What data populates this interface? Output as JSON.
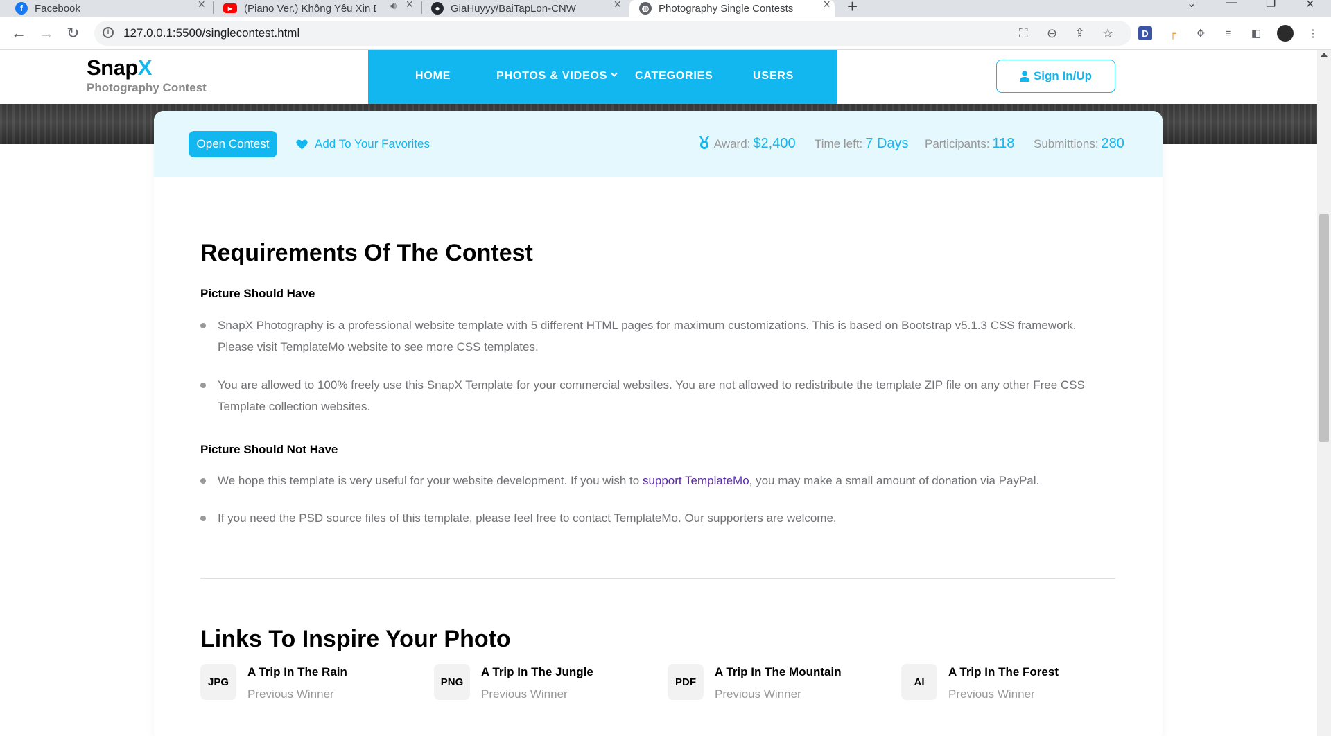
{
  "browser": {
    "tabs": [
      {
        "title": "Facebook",
        "active": false
      },
      {
        "title": "(Piano Ver.) Không Yêu Xin Đừng...",
        "active": false
      },
      {
        "title": "GiaHuyyy/BaiTapLon-CNW",
        "active": false
      },
      {
        "title": "Photography Single Contests",
        "active": true
      }
    ],
    "url": "127.0.0.1:5500/singlecontest.html"
  },
  "header": {
    "brand_main": "Snap",
    "brand_x": "X",
    "brand_sub": "Photography Contest",
    "nav": [
      "HOME",
      "PHOTOS & VIDEOS",
      "CATEGORIES",
      "USERS"
    ],
    "signin_label": "Sign In/Up"
  },
  "contest": {
    "open_label": "Open Contest",
    "favorite_label": "Add To Your Favorites",
    "award_label": "Award:",
    "award_value": "$2,400",
    "time_label": "Time left:",
    "time_value": "7 Days",
    "participants_label": "Participants:",
    "participants_value": "118",
    "submissions_label": "Submittions:",
    "submissions_value": "280"
  },
  "requirements": {
    "title": "Requirements Of The Contest",
    "should_have_title": "Picture Should Have",
    "should_have": [
      "SnapX Photography is a professional website template with 5 different HTML pages for maximum customizations. This is based on Bootstrap v5.1.3 CSS framework. Please visit TemplateMo website to see more CSS templates.",
      "You are allowed to 100% freely use this SnapX Template for your commercial websites. You are not allowed to redistribute the template ZIP file on any other Free CSS Template collection websites."
    ],
    "should_not_title": "Picture Should Not Have",
    "should_not_1_before": "We hope this template is very useful for your website development. If you wish to ",
    "should_not_1_link": "support TemplateMo",
    "should_not_1_after": ", you may make a small amount of donation via PayPal.",
    "should_not_2": "If you need the PSD source files of this template, please feel free to contact TemplateMo. Our supporters are welcome."
  },
  "inspire": {
    "title": "Links To Inspire Your Photo",
    "links": [
      {
        "type": "JPG",
        "title": "A Trip In The Rain",
        "subtitle": "Previous Winner"
      },
      {
        "type": "PNG",
        "title": "A Trip In The Jungle",
        "subtitle": "Previous Winner"
      },
      {
        "type": "PDF",
        "title": "A Trip In The Mountain",
        "subtitle": "Previous Winner"
      },
      {
        "type": "AI",
        "title": "A Trip In The Forest",
        "subtitle": "Previous Winner"
      }
    ]
  },
  "colors": {
    "accent": "#13b7f0",
    "card_top_bg": "#e5f8fd",
    "link": "#5a2ba6"
  }
}
